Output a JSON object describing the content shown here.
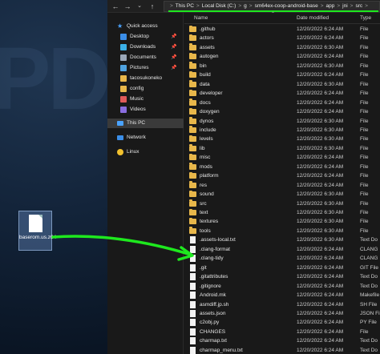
{
  "desktop": {
    "file_label": "baserom.us.z64"
  },
  "addressbar": {
    "crumbs": [
      "This PC",
      "Local Disk (C:)",
      "g",
      "sm64ex-coop-android-base",
      "app",
      "jni",
      "src"
    ],
    "prefix": ">"
  },
  "columns": {
    "name": "Name",
    "date": "Date modified",
    "type": "Type"
  },
  "sidebar": {
    "quick_access": "Quick access",
    "items": [
      {
        "label": "Desktop",
        "pinned": true,
        "icon": "desktop-icon"
      },
      {
        "label": "Downloads",
        "pinned": true,
        "icon": "downloads-icon"
      },
      {
        "label": "Documents",
        "pinned": true,
        "icon": "documents-icon"
      },
      {
        "label": "Pictures",
        "pinned": true,
        "icon": "pictures-icon"
      },
      {
        "label": "tacosukoneko",
        "pinned": false,
        "icon": "folder-icon"
      },
      {
        "label": "config",
        "pinned": false,
        "icon": "folder-icon"
      },
      {
        "label": "Music",
        "pinned": false,
        "icon": "music-icon"
      },
      {
        "label": "Videos",
        "pinned": false,
        "icon": "videos-icon"
      }
    ],
    "this_pc": "This PC",
    "network": "Network",
    "linux": "Linux",
    "pin_glyph": "📌"
  },
  "files": [
    {
      "name": ".github",
      "date": "12/20/2022 6:24 AM",
      "type": "File",
      "kind": "folder"
    },
    {
      "name": "actors",
      "date": "12/20/2022 6:24 AM",
      "type": "File",
      "kind": "folder"
    },
    {
      "name": "assets",
      "date": "12/20/2022 6:30 AM",
      "type": "File",
      "kind": "folder"
    },
    {
      "name": "autogen",
      "date": "12/20/2022 6:24 AM",
      "type": "File",
      "kind": "folder"
    },
    {
      "name": "bin",
      "date": "12/20/2022 6:30 AM",
      "type": "File",
      "kind": "folder"
    },
    {
      "name": "build",
      "date": "12/20/2022 6:24 AM",
      "type": "File",
      "kind": "folder"
    },
    {
      "name": "data",
      "date": "12/20/2022 6:30 AM",
      "type": "File",
      "kind": "folder"
    },
    {
      "name": "developer",
      "date": "12/20/2022 6:24 AM",
      "type": "File",
      "kind": "folder"
    },
    {
      "name": "docs",
      "date": "12/20/2022 6:24 AM",
      "type": "File",
      "kind": "folder"
    },
    {
      "name": "doxygen",
      "date": "12/20/2022 6:24 AM",
      "type": "File",
      "kind": "folder"
    },
    {
      "name": "dynos",
      "date": "12/20/2022 6:30 AM",
      "type": "File",
      "kind": "folder"
    },
    {
      "name": "include",
      "date": "12/20/2022 6:30 AM",
      "type": "File",
      "kind": "folder"
    },
    {
      "name": "levels",
      "date": "12/20/2022 6:30 AM",
      "type": "File",
      "kind": "folder"
    },
    {
      "name": "lib",
      "date": "12/20/2022 6:30 AM",
      "type": "File",
      "kind": "folder"
    },
    {
      "name": "misc",
      "date": "12/20/2022 6:24 AM",
      "type": "File",
      "kind": "folder"
    },
    {
      "name": "mods",
      "date": "12/20/2022 6:24 AM",
      "type": "File",
      "kind": "folder"
    },
    {
      "name": "platform",
      "date": "12/20/2022 6:24 AM",
      "type": "File",
      "kind": "folder"
    },
    {
      "name": "res",
      "date": "12/20/2022 6:24 AM",
      "type": "File",
      "kind": "folder"
    },
    {
      "name": "sound",
      "date": "12/20/2022 6:30 AM",
      "type": "File",
      "kind": "folder"
    },
    {
      "name": "src",
      "date": "12/20/2022 6:30 AM",
      "type": "File",
      "kind": "folder"
    },
    {
      "name": "text",
      "date": "12/20/2022 6:30 AM",
      "type": "File",
      "kind": "folder"
    },
    {
      "name": "textures",
      "date": "12/20/2022 6:30 AM",
      "type": "File",
      "kind": "folder"
    },
    {
      "name": "tools",
      "date": "12/20/2022 6:30 AM",
      "type": "File",
      "kind": "folder"
    },
    {
      "name": ".assets-local.txt",
      "date": "12/20/2022 6:30 AM",
      "type": "Text Do",
      "kind": "file"
    },
    {
      "name": ".clang-format",
      "date": "12/20/2022 6:24 AM",
      "type": "CLANG",
      "kind": "file"
    },
    {
      "name": ".clang-tidy",
      "date": "12/20/2022 6:24 AM",
      "type": "CLANG",
      "kind": "file"
    },
    {
      "name": ".git",
      "date": "12/20/2022 6:24 AM",
      "type": "GIT File",
      "kind": "file"
    },
    {
      "name": ".gitattributes",
      "date": "12/20/2022 6:24 AM",
      "type": "Text Do",
      "kind": "file"
    },
    {
      "name": ".gitignore",
      "date": "12/20/2022 6:24 AM",
      "type": "Text Do",
      "kind": "file"
    },
    {
      "name": "Android.mk",
      "date": "12/20/2022 6:24 AM",
      "type": "Makefile",
      "kind": "file"
    },
    {
      "name": "asmdiff.jp.sh",
      "date": "12/20/2022 6:24 AM",
      "type": "SH File",
      "kind": "file"
    },
    {
      "name": "assets.json",
      "date": "12/20/2022 6:24 AM",
      "type": "JSON File",
      "kind": "file"
    },
    {
      "name": "c2obj.py",
      "date": "12/20/2022 6:24 AM",
      "type": "PY File",
      "kind": "file"
    },
    {
      "name": "CHANGES",
      "date": "12/20/2022 6:24 AM",
      "type": "File",
      "kind": "file"
    },
    {
      "name": "charmap.txt",
      "date": "12/20/2022 6:24 AM",
      "type": "Text Do",
      "kind": "file"
    },
    {
      "name": "charmap_menu.txt",
      "date": "12/20/2022 6:24 AM",
      "type": "Text Do",
      "kind": "file"
    }
  ],
  "annotation_color": "#1ee81e"
}
